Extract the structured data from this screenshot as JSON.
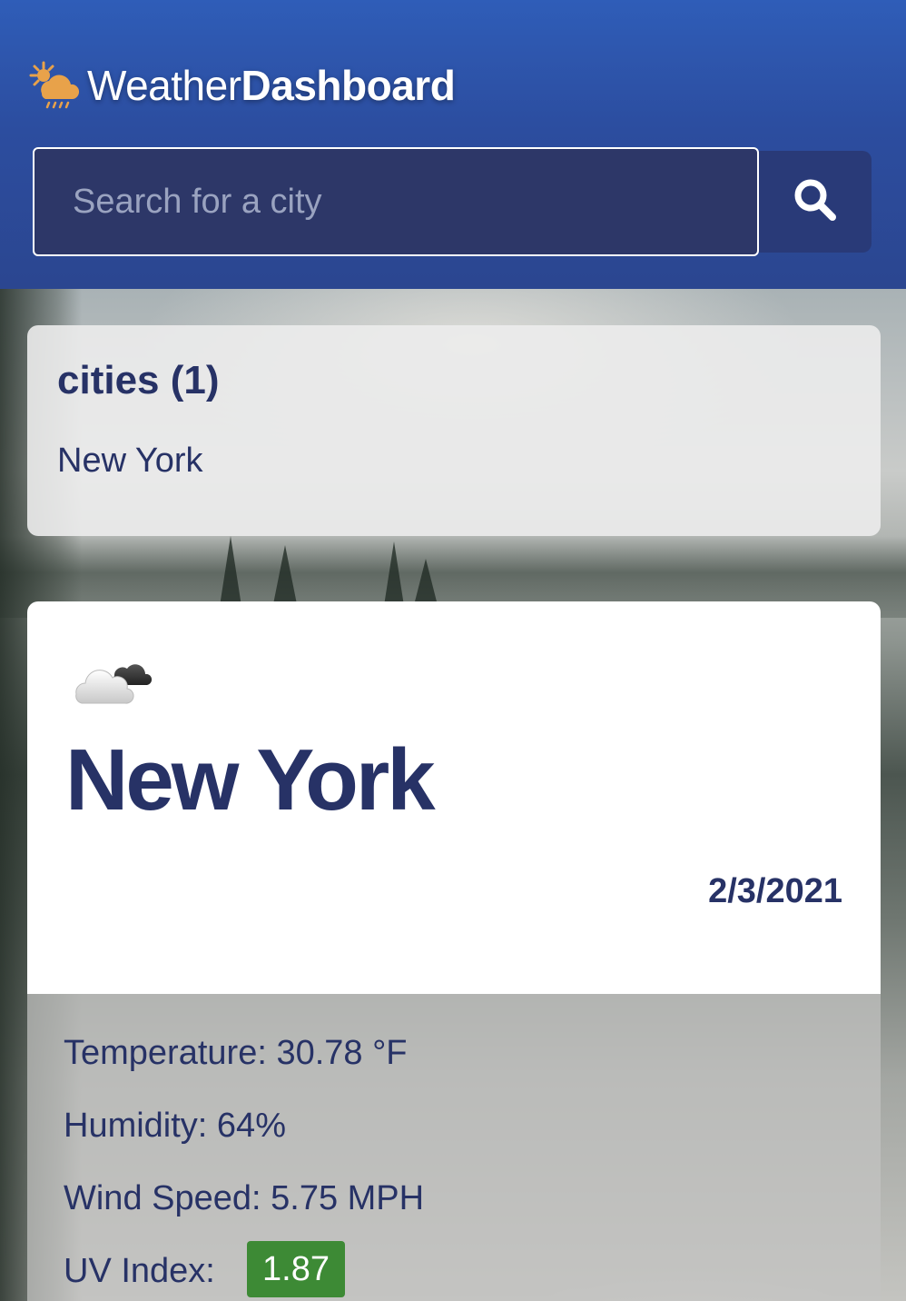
{
  "header": {
    "brand_light": "Weather",
    "brand_bold": "Dashboard",
    "brand_icon": "sun-cloud-rain-icon",
    "search_placeholder": "Search for a city",
    "search_icon": "search-icon"
  },
  "cities": {
    "title": "cities (1)",
    "items": [
      "New York"
    ]
  },
  "weather": {
    "icon": "cloud-icon",
    "city": "New York",
    "date": "2/3/2021",
    "temperature": "Temperature: 30.78 °F",
    "humidity": "Humidity: 64%",
    "wind": "Wind Speed: 5.75 MPH",
    "uv_label": "UV Index:",
    "uv_value": "1.87"
  },
  "colors": {
    "header_blue": "#2c4d9f",
    "text_navy": "#273266",
    "uv_green": "#3d8a35"
  }
}
